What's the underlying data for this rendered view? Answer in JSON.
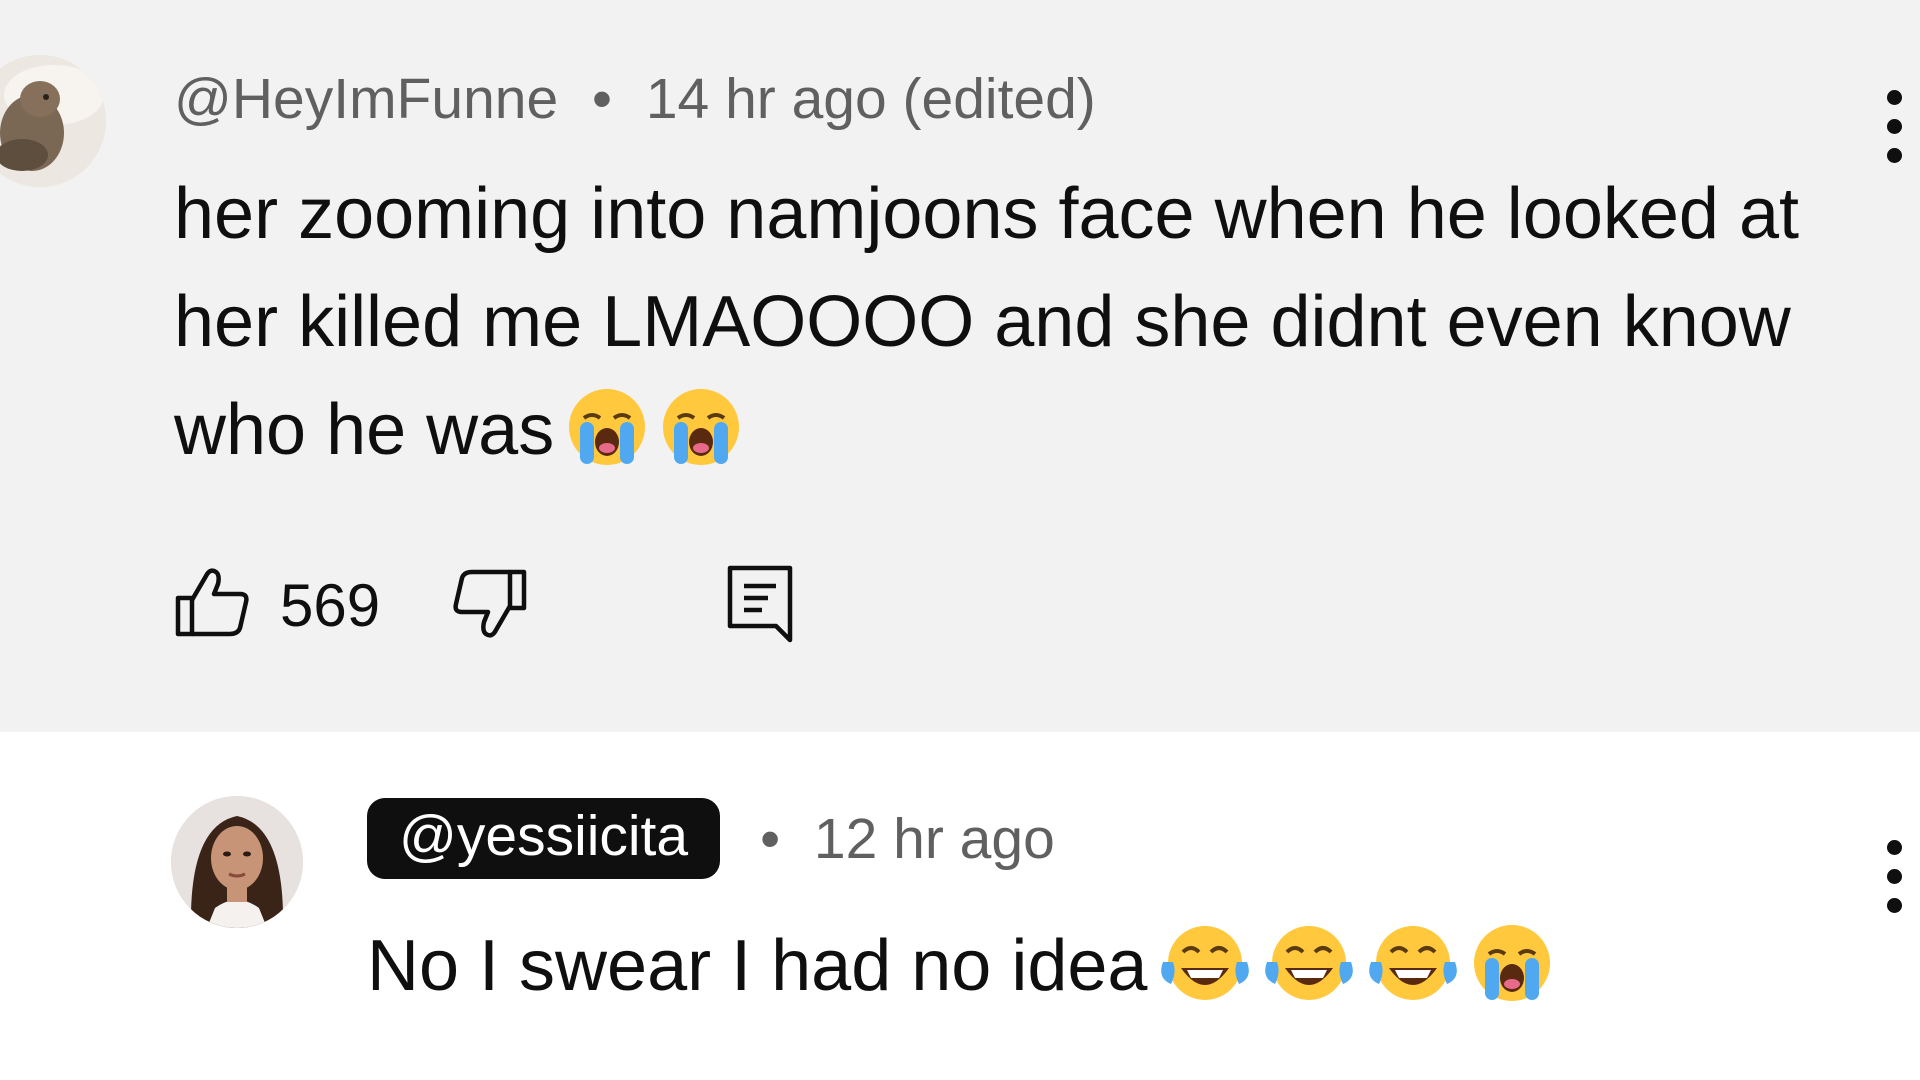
{
  "comments": [
    {
      "author": "@HeyImFunne",
      "time": "14 hr ago (edited)",
      "separator": "•",
      "text": "her zooming into namjoons face when he looked at her killed me LMAOOOO and she didnt even know who he was",
      "emojis": [
        "loudly-crying-face",
        "loudly-crying-face"
      ],
      "likes": "569",
      "background": "#f2f2f2"
    },
    {
      "author": "@yessiicita",
      "time": "12 hr ago",
      "separator": "•",
      "text": "No I swear I had no idea",
      "emojis": [
        "face-with-tears-of-joy",
        "face-with-tears-of-joy",
        "face-with-tears-of-joy",
        "loudly-crying-face"
      ],
      "author_badge_color": "#0f0f0f",
      "background": "#ffffff"
    }
  ],
  "icons": {
    "like": "thumbs-up-icon",
    "dislike": "thumbs-down-icon",
    "reply": "comment-reply-icon",
    "menu": "more-vertical-icon"
  }
}
